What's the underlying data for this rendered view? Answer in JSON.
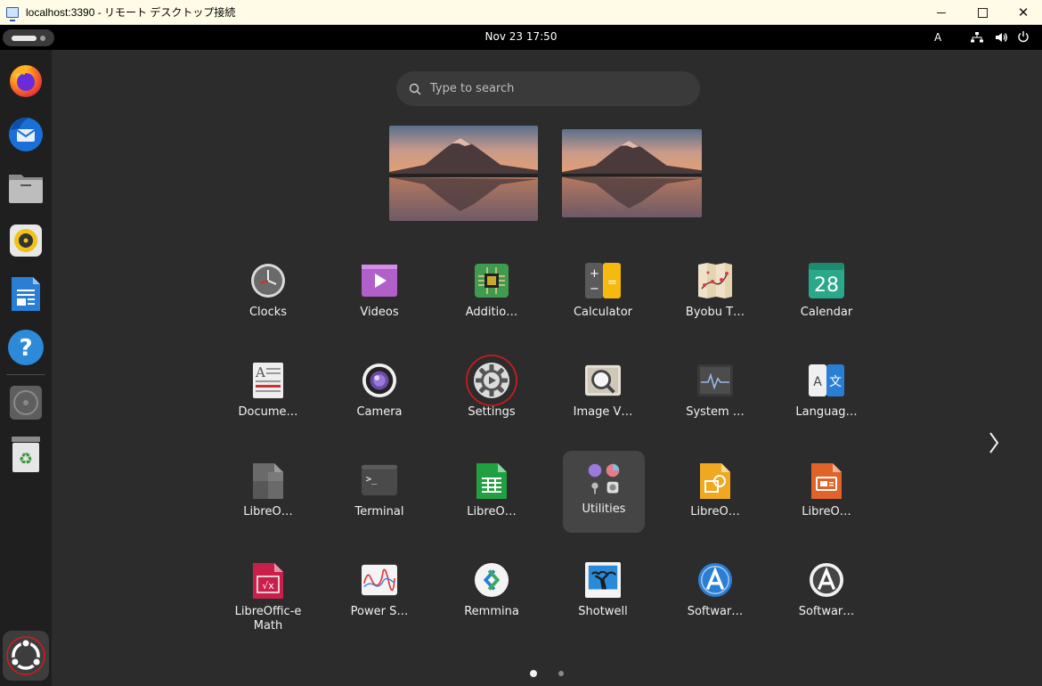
{
  "window": {
    "title": "localhost:3390 - リモート デスクトップ接続",
    "close_glyph": "✕"
  },
  "topbar": {
    "clock": "Nov 23  17:50",
    "input_indicator": "A"
  },
  "dock": {
    "items": [
      {
        "name": "firefox",
        "icon": "firefox-icon"
      },
      {
        "name": "thunderbird",
        "icon": "thunderbird-icon"
      },
      {
        "name": "files",
        "icon": "files-icon"
      },
      {
        "name": "rhythmbox",
        "icon": "rhythmbox-icon"
      },
      {
        "name": "libreoffice-writer",
        "icon": "writer-icon"
      },
      {
        "name": "help",
        "icon": "help-icon"
      },
      {
        "name": "disc",
        "icon": "disc-icon"
      },
      {
        "name": "trash",
        "icon": "trash-icon"
      },
      {
        "name": "show-apps",
        "icon": "ubuntu-apps-icon"
      }
    ],
    "help_glyph": "?",
    "trash_glyph": "♻"
  },
  "search": {
    "placeholder": "Type to search"
  },
  "apps": [
    {
      "label": "Clocks",
      "icon": "clock-icon"
    },
    {
      "label": "Videos",
      "icon": "video-icon"
    },
    {
      "label": "Additio…",
      "icon": "chip-icon"
    },
    {
      "label": "Calculator",
      "icon": "calculator-icon"
    },
    {
      "label": "Byobu T…",
      "icon": "byobu-icon"
    },
    {
      "label": "Calendar",
      "icon": "calendar-icon",
      "day": "28"
    },
    {
      "label": "Docume…",
      "icon": "document-viewer-icon",
      "glyph": "A"
    },
    {
      "label": "Camera",
      "icon": "camera-icon"
    },
    {
      "label": "Settings",
      "icon": "gear-icon"
    },
    {
      "label": "Image V…",
      "icon": "image-viewer-icon"
    },
    {
      "label": "System …",
      "icon": "system-monitor-icon"
    },
    {
      "label": "Languag…",
      "icon": "language-icon",
      "glyph_a": "A",
      "glyph_b": "文"
    },
    {
      "label": "LibreO…",
      "icon": "libreoffice-icon"
    },
    {
      "label": "Terminal",
      "icon": "terminal-icon",
      "glyph": ">_"
    },
    {
      "label": "LibreO…",
      "icon": "calc-icon"
    },
    {
      "label": "Utilities",
      "icon": "utilities-folder-icon"
    },
    {
      "label": "LibreO…",
      "icon": "draw-icon"
    },
    {
      "label": "LibreO…",
      "icon": "impress-icon"
    },
    {
      "label": "LibreOffic-e Math",
      "icon": "math-icon",
      "glyph": "√x"
    },
    {
      "label": "Power S…",
      "icon": "power-stats-icon"
    },
    {
      "label": "Remmina",
      "icon": "remmina-icon"
    },
    {
      "label": "Shotwell",
      "icon": "shotwell-icon"
    },
    {
      "label": "Softwar…",
      "icon": "software-icon"
    },
    {
      "label": "Softwar…",
      "icon": "software-updater-icon"
    }
  ],
  "pagination": {
    "pages": 2,
    "current": 1
  },
  "colors": {
    "background": "#2c2c2c",
    "dock": "#1f1f1f",
    "highlight": "#454545",
    "annotation_red": "#d81b1b"
  }
}
